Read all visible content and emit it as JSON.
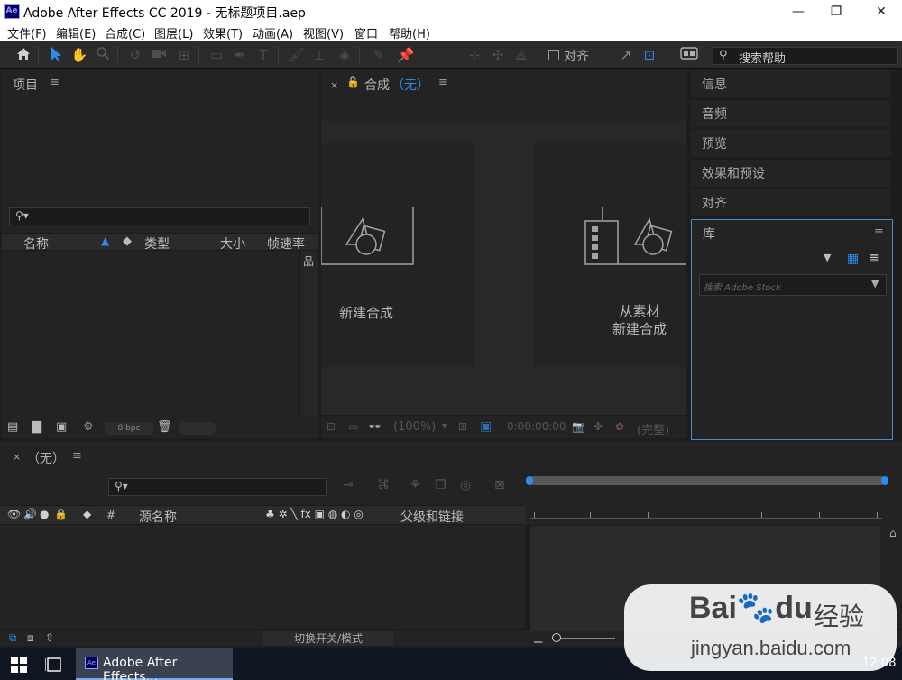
{
  "window": {
    "title": "Adobe After Effects CC 2019 - 无标题项目.aep",
    "logo_text": "Ae",
    "controls": {
      "minimize": "—",
      "restore": "❐",
      "close": "✕"
    }
  },
  "menu": {
    "items": [
      "文件(F)",
      "编辑(E)",
      "合成(C)",
      "图层(L)",
      "效果(T)",
      "动画(A)",
      "视图(V)",
      "窗口",
      "帮助(H)"
    ]
  },
  "toolbar": {
    "align_label": "对齐",
    "search_help_placeholder": "搜索帮助"
  },
  "project": {
    "title": "项目",
    "columns": [
      "名称",
      "类型",
      "大小",
      "帧速率"
    ],
    "bpc": "8 bpc"
  },
  "composition": {
    "tab_label": "合成",
    "tab_value": "（无）",
    "cards": {
      "new_comp": "新建合成",
      "from_footage_line1": "从素材",
      "from_footage_line2": "新建合成"
    },
    "bottom_bar": {
      "zoom": "(100%)",
      "timecode": "0:00:00:00",
      "quality": "(完整)"
    }
  },
  "right_panels": {
    "tabs": [
      "信息",
      "音频",
      "预览",
      "效果和预设",
      "对齐"
    ],
    "library": {
      "title": "库",
      "search_placeholder": "搜索 Adobe Stock"
    }
  },
  "timeline": {
    "tab_label": "（无）",
    "columns": {
      "hash": "#",
      "source_name": "源名称",
      "parent": "父级和链接"
    },
    "toggle_label": "切换开关/模式"
  },
  "taskbar": {
    "app_label": "Adobe After Effects...",
    "clock": "12:08"
  },
  "watermark": {
    "brand_text": "Bai",
    "brand_du": "du",
    "cn_text": "经验",
    "url": "jingyan.baidu.com"
  },
  "colors": {
    "accent_blue": "#2d8ceb",
    "panel_bg": "#232323",
    "app_bg": "#1d1d1d"
  }
}
